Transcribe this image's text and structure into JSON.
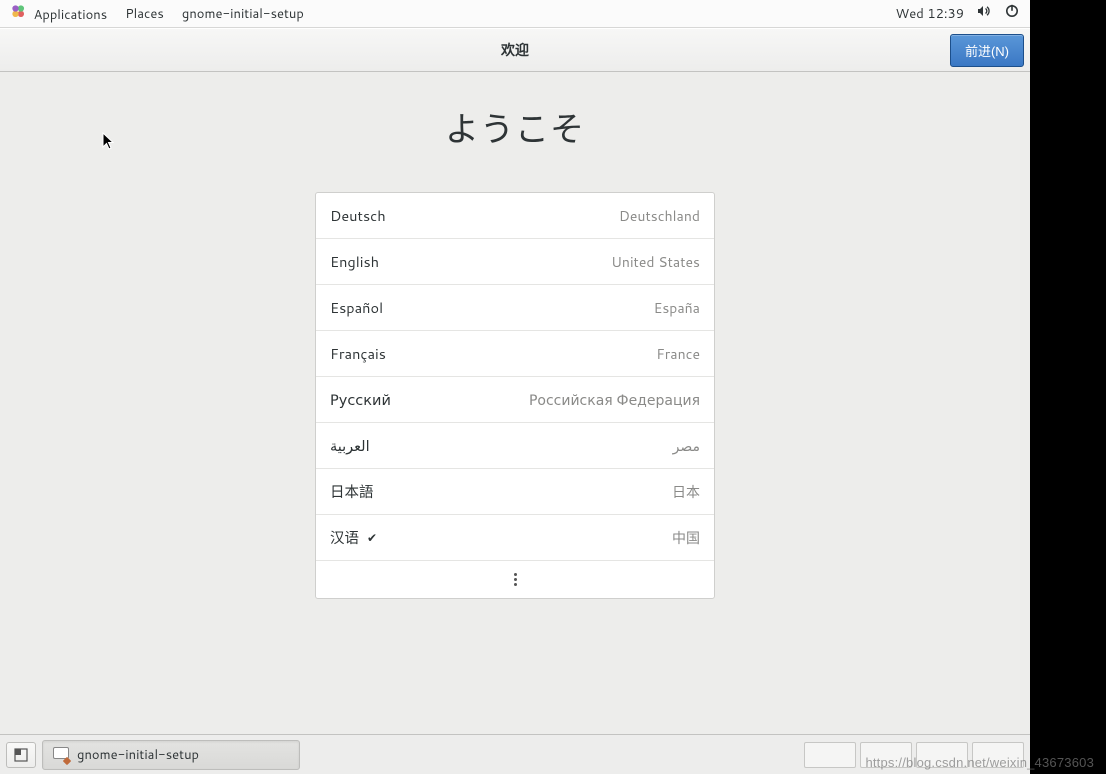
{
  "topbar": {
    "applications": "Applications",
    "places": "Places",
    "app_title": "gnome-initial-setup",
    "clock": "Wed 12:39"
  },
  "header": {
    "title": "欢迎",
    "next_button": "前进(N)"
  },
  "main": {
    "big_title": "ようこそ"
  },
  "languages": [
    {
      "label": "Deutsch",
      "region": "Deutschland",
      "selected": false
    },
    {
      "label": "English",
      "region": "United States",
      "selected": false
    },
    {
      "label": "Español",
      "region": "España",
      "selected": false
    },
    {
      "label": "Français",
      "region": "France",
      "selected": false
    },
    {
      "label": "Русский",
      "region": "Российская Федерация",
      "selected": false
    },
    {
      "label": "العربية",
      "region": "مصر",
      "selected": false
    },
    {
      "label": "日本語",
      "region": "日本",
      "selected": false
    },
    {
      "label": "汉语",
      "region": "中国",
      "selected": true
    }
  ],
  "taskbar": {
    "task_label": "gnome-initial-setup"
  },
  "watermark": "https://blog.csdn.net/weixin_43673603"
}
